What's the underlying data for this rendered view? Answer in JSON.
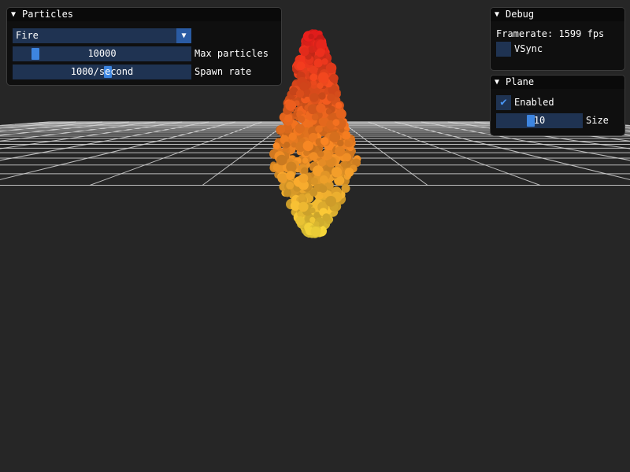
{
  "particles_window": {
    "title": "Particles",
    "effect_combo": {
      "value": "Fire"
    },
    "max_particles": {
      "value": "10000",
      "label": "Max particles",
      "fraction": 0.1
    },
    "spawn_rate": {
      "value": "1000/second",
      "label": "Spawn rate",
      "fraction": 0.5
    }
  },
  "debug_window": {
    "title": "Debug",
    "framerate_text": "Framerate: 1599 fps",
    "vsync": {
      "label": "VSync",
      "checked": false
    }
  },
  "plane_window": {
    "title": "Plane",
    "enabled": {
      "label": "Enabled",
      "checked": true
    },
    "size": {
      "value": "10",
      "label": "Size",
      "fraction": 0.45
    }
  },
  "colors": {
    "background": "#262626",
    "grid": "#d8d8d8",
    "frame_bg": "#1f3352",
    "accent": "#3d85e0",
    "fire_top": "#e81c1c",
    "fire_mid": "#f27a20",
    "fire_bottom": "#f2d63a"
  }
}
